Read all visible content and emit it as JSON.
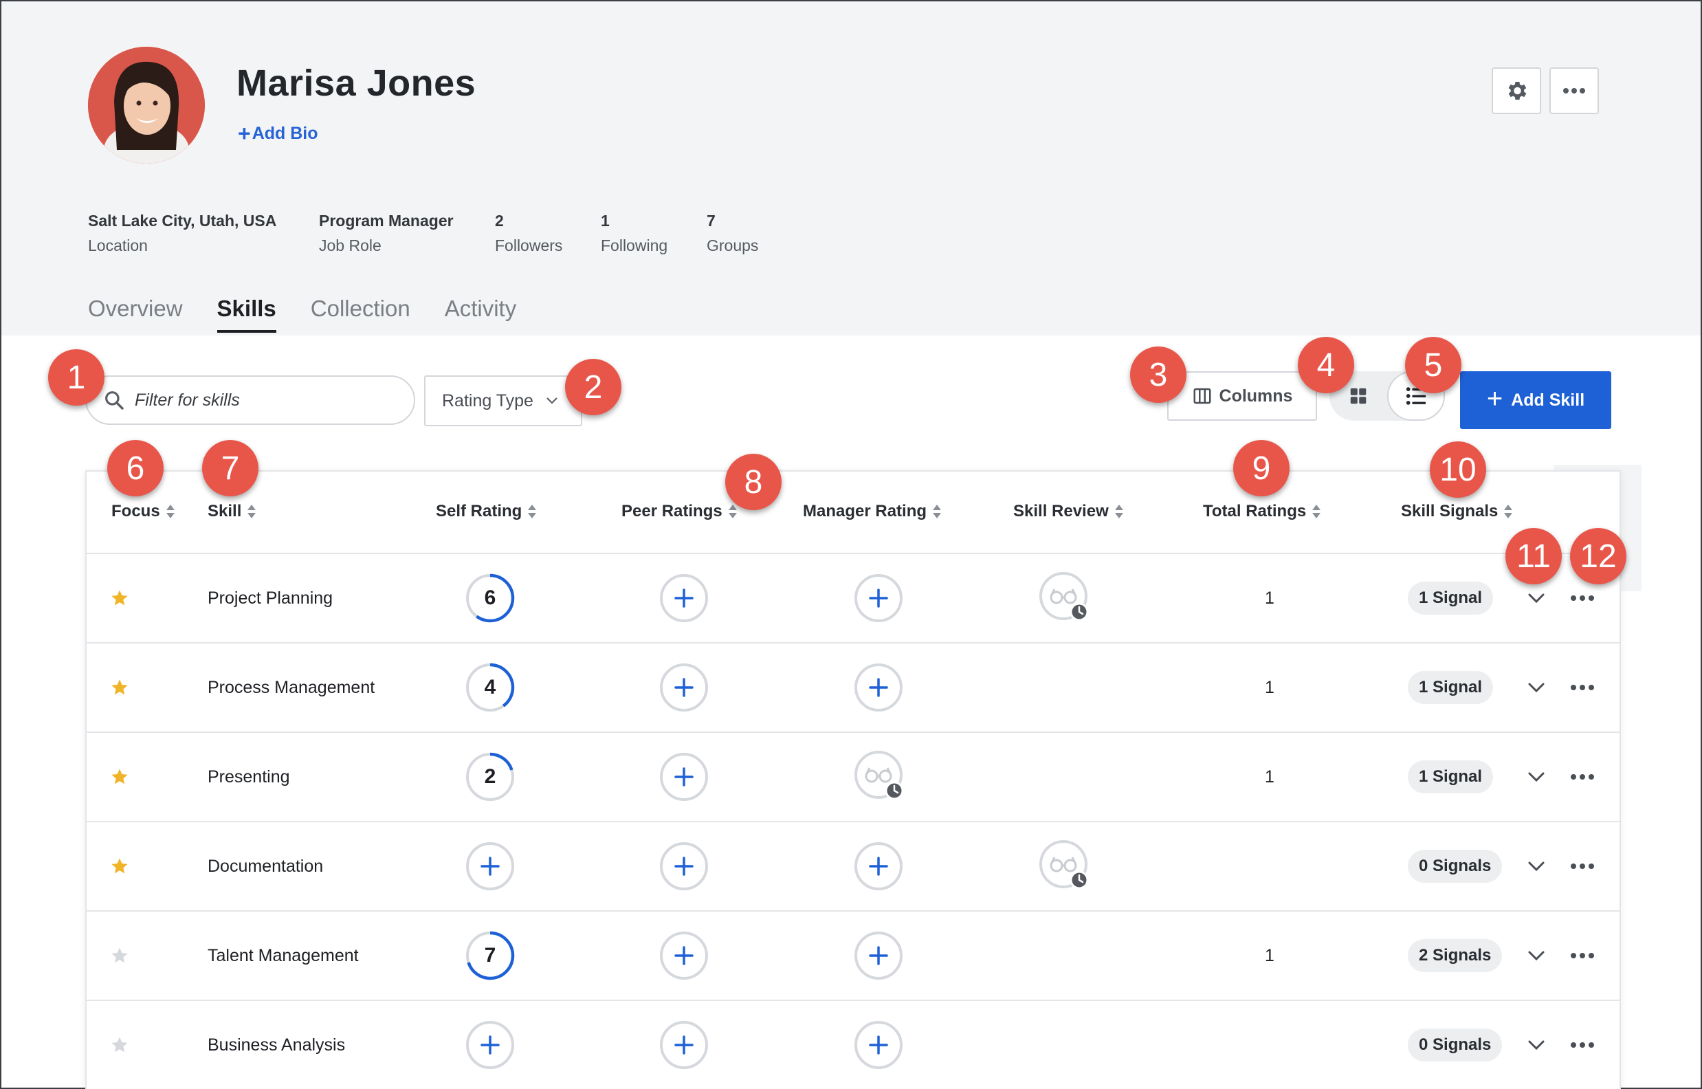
{
  "profile": {
    "name": "Marisa Jones",
    "add_bio": "Add Bio",
    "stats": [
      {
        "value": "Salt Lake City, Utah, USA",
        "label": "Location"
      },
      {
        "value": "Program Manager",
        "label": "Job Role"
      },
      {
        "value": "2",
        "label": "Followers"
      },
      {
        "value": "1",
        "label": "Following"
      },
      {
        "value": "7",
        "label": "Groups"
      }
    ]
  },
  "tabs": [
    {
      "label": "Overview",
      "active": false
    },
    {
      "label": "Skills",
      "active": true
    },
    {
      "label": "Collection",
      "active": false
    },
    {
      "label": "Activity",
      "active": false
    }
  ],
  "toolbar": {
    "filter_placeholder": "Filter for skills",
    "rating_type_label": "Rating Type",
    "columns_label": "Columns",
    "add_skill_label": "Add Skill"
  },
  "columns": {
    "focus": "Focus",
    "skill": "Skill",
    "self_rating": "Self Rating",
    "peer_ratings": "Peer Ratings",
    "manager_rating": "Manager Rating",
    "skill_review": "Skill Review",
    "total_ratings": "Total Ratings",
    "skill_signals": "Skill Signals"
  },
  "rows": [
    {
      "focus": true,
      "skill": "Project Planning",
      "self_rating": "6",
      "self_fill": 0.6,
      "manager": "add",
      "review": "pending",
      "total": "1",
      "signals": "1 Signal"
    },
    {
      "focus": true,
      "skill": "Process Management",
      "self_rating": "4",
      "self_fill": 0.4,
      "manager": "add",
      "review": "",
      "total": "1",
      "signals": "1 Signal"
    },
    {
      "focus": true,
      "skill": "Presenting",
      "self_rating": "2",
      "self_fill": 0.2,
      "manager": "pending",
      "review": "",
      "total": "1",
      "signals": "1 Signal"
    },
    {
      "focus": true,
      "skill": "Documentation",
      "self_rating": "",
      "self_fill": 0,
      "manager": "add",
      "review": "pending",
      "total": "",
      "signals": "0 Signals"
    },
    {
      "focus": false,
      "skill": "Talent Management",
      "self_rating": "7",
      "self_fill": 0.7,
      "manager": "add",
      "review": "",
      "total": "1",
      "signals": "2 Signals"
    },
    {
      "focus": false,
      "skill": "Business Analysis",
      "self_rating": "",
      "self_fill": 0,
      "manager": "add",
      "review": "",
      "total": "",
      "signals": "0 Signals"
    }
  ],
  "callouts": [
    "1",
    "2",
    "3",
    "4",
    "5",
    "6",
    "7",
    "8",
    "9",
    "10",
    "11",
    "12"
  ],
  "colors": {
    "accent": "#1e61d6",
    "callout": "#e8564a",
    "star_on": "#f0b429",
    "star_off": "#d5d8dc",
    "header_bg": "#f3f4f5"
  }
}
